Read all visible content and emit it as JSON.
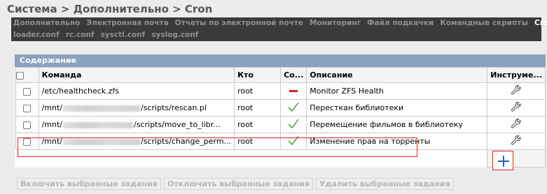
{
  "breadcrumb": {
    "text": "Система > Дополнительно > Cron"
  },
  "tabs": {
    "row1": [
      "Дополнительно",
      "Электронная почта",
      "Отчеты по электронной почте",
      "Мониторинг",
      "Файл подкачки",
      "Командные скрипты",
      "Cron"
    ],
    "row2": [
      "loader.conf",
      "rc.conf",
      "sysctl.conf",
      "syslog.conf"
    ],
    "active": "Cron"
  },
  "panel": {
    "title": "Содержание"
  },
  "table": {
    "headers": {
      "command": "Команда",
      "who": "Кто",
      "status": "Со...",
      "description": "Описание",
      "tools": "Инструме..."
    },
    "rows": [
      {
        "command_prefix": "/etc/healthcheck.zfs",
        "command_suffix": "",
        "who": "root",
        "status": "disabled",
        "description": "Monitor ZFS Health"
      },
      {
        "command_prefix": "/mnt/",
        "command_suffix": "/scripts/rescan.pl",
        "who": "root",
        "status": "enabled",
        "description": "Пересткан библиотеки"
      },
      {
        "command_prefix": "/mnt/",
        "command_suffix": "/scripts/move_to_libr...",
        "who": "root",
        "status": "enabled",
        "description": "Перемещение фильмов в библиотеку"
      },
      {
        "command_prefix": "/mnt/",
        "command_suffix": "/scripts/change_perm...",
        "who": "root",
        "status": "enabled",
        "description": "Изменение прав на торренты"
      }
    ]
  },
  "buttons": {
    "enable": "Включить выбранные задания",
    "disable": "Отключить выбранные задания",
    "delete": "Удалить выбранные задания"
  },
  "colors": {
    "enabled": "#3a9b2a",
    "disabled": "#cc2222",
    "panel_header": "#8aa3be",
    "highlight": "#d22222",
    "add": "#2b63b8"
  }
}
